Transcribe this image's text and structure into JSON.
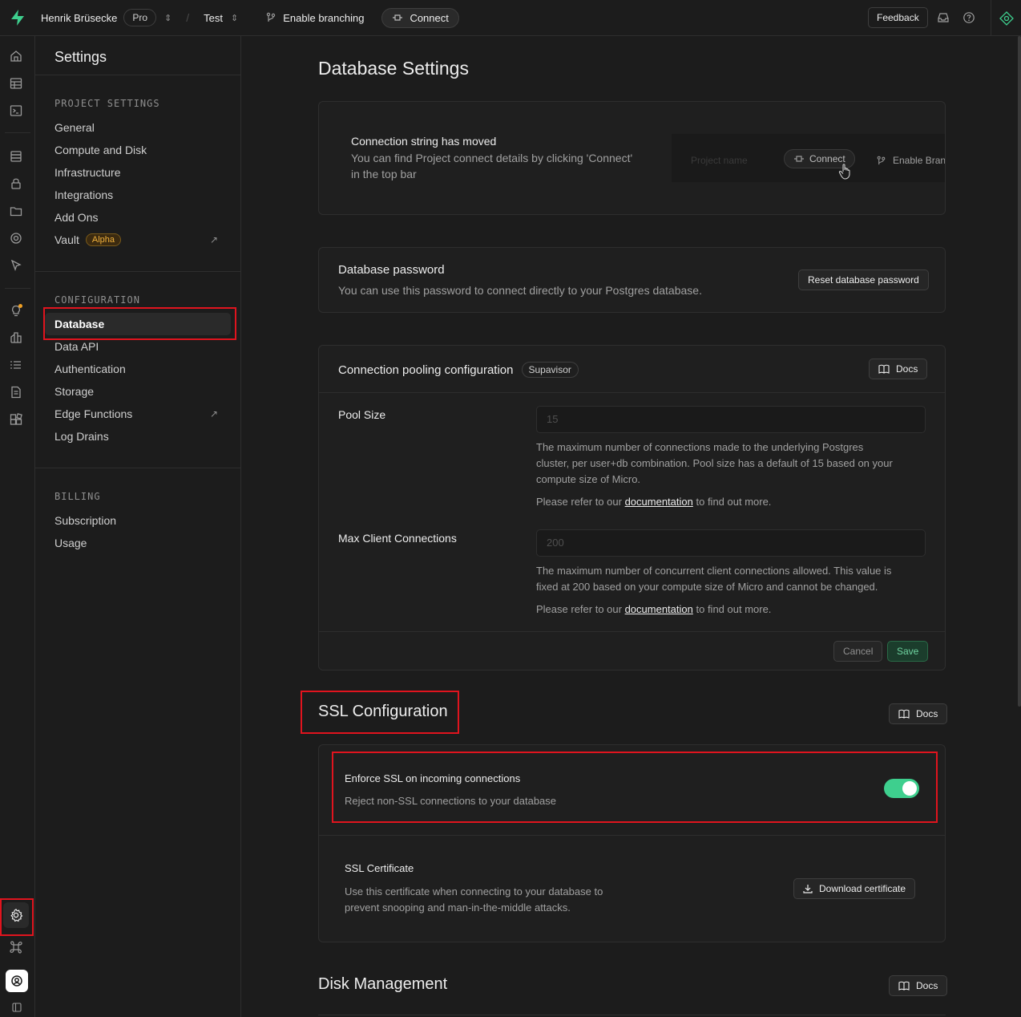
{
  "topbar": {
    "org_name": "Henrik Brüsecke",
    "plan_badge": "Pro",
    "project_name": "Test",
    "branching_label": "Enable branching",
    "connect_label": "Connect",
    "feedback_label": "Feedback"
  },
  "sidebar": {
    "title": "Settings",
    "sections": [
      {
        "heading": "PROJECT SETTINGS",
        "items": [
          {
            "label": "General"
          },
          {
            "label": "Compute and Disk"
          },
          {
            "label": "Infrastructure"
          },
          {
            "label": "Integrations"
          },
          {
            "label": "Add Ons"
          },
          {
            "label": "Vault",
            "badge": "Alpha"
          }
        ]
      },
      {
        "heading": "CONFIGURATION",
        "items": [
          {
            "label": "Database"
          },
          {
            "label": "Data API"
          },
          {
            "label": "Authentication"
          },
          {
            "label": "Storage"
          },
          {
            "label": "Edge Functions"
          },
          {
            "label": "Log Drains"
          }
        ]
      },
      {
        "heading": "BILLING",
        "items": [
          {
            "label": "Subscription"
          },
          {
            "label": "Usage"
          }
        ]
      }
    ]
  },
  "main": {
    "page_title": "Database Settings",
    "connection_notice": {
      "title": "Connection string has moved",
      "line1": "You can find Project connect details by clicking 'Connect'",
      "line2": "in the top bar",
      "preview_project": "Project name",
      "preview_connect": "Connect",
      "preview_branch": "Enable Bran"
    },
    "db_password": {
      "title": "Database password",
      "description": "You can use this password to connect directly to your Postgres database.",
      "reset_label": "Reset database password"
    },
    "pooling": {
      "title": "Connection pooling configuration",
      "badge": "Supavisor",
      "docs_label": "Docs",
      "pool_size_label": "Pool Size",
      "pool_size_value": "15",
      "pool_size_help_1": "The maximum number of connections made to the underlying Postgres",
      "pool_size_help_2": "cluster, per user+db combination. Pool size has a default of 15 based on your",
      "pool_size_help_3": "compute size of Micro.",
      "refer_prefix": "Please refer to our",
      "refer_link": "documentation",
      "refer_suffix": "to find out more.",
      "max_client_label": "Max Client Connections",
      "max_client_value": "200",
      "max_client_help_1": "The maximum number of concurrent client connections allowed. This value is",
      "max_client_help_2": "fixed at 200 based on your compute size of Micro and cannot be changed.",
      "cancel_label": "Cancel",
      "save_label": "Save"
    },
    "ssl": {
      "title": "SSL Configuration",
      "docs_label": "Docs",
      "enforce_title": "Enforce SSL on incoming connections",
      "enforce_desc": "Reject non-SSL connections to your database",
      "enforce_enabled": true,
      "cert_title": "SSL Certificate",
      "cert_desc_1": "Use this certificate when connecting to your database to",
      "cert_desc_2": "prevent snooping and man-in-the-middle attacks.",
      "download_label": "Download certificate"
    },
    "disk": {
      "title": "Disk Management",
      "docs_label": "Docs"
    }
  },
  "colors": {
    "brand": "#3ecf8e",
    "highlight": "#e0141e",
    "alpha": "#f0b13c"
  }
}
